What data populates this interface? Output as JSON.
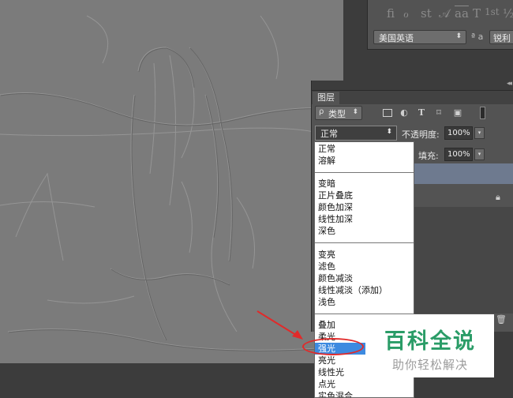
{
  "character_panel": {
    "style_glyphs": [
      "fi",
      "ℴ",
      "st",
      "𝒜",
      "aa",
      "T",
      "1st",
      "½"
    ],
    "language": "美国英语",
    "aa_icon": "ª a",
    "antialias": "锐利"
  },
  "layers_panel": {
    "tab_label": "图层",
    "filter_search_icon": "ρ",
    "filter_type": "类型",
    "filter_icons": [
      "image-icon",
      "adjustment-icon",
      "text-icon",
      "shape-icon",
      "smart-object-icon"
    ],
    "blend_mode": "正常",
    "opacity_label": "不透明度:",
    "opacity_value": "100%",
    "fill_label": "填充:",
    "fill_value": "100%"
  },
  "blend_menu": {
    "groups": [
      [
        "正常",
        "溶解"
      ],
      [
        "变暗",
        "正片叠底",
        "颜色加深",
        "线性加深",
        "深色"
      ],
      [
        "变亮",
        "滤色",
        "颜色减淡",
        "线性减淡（添加）",
        "浅色"
      ],
      [
        "叠加",
        "柔光",
        "强光",
        "亮光",
        "线性光",
        "点光",
        "实色混合"
      ]
    ],
    "highlighted": "强光"
  },
  "watermark": {
    "brand": "百科全说",
    "slogan": "助你轻松解决"
  },
  "colors": {
    "highlight": "#3d8ae0",
    "annotation_red": "#e12a2a",
    "brand_green": "#2a9c67"
  }
}
